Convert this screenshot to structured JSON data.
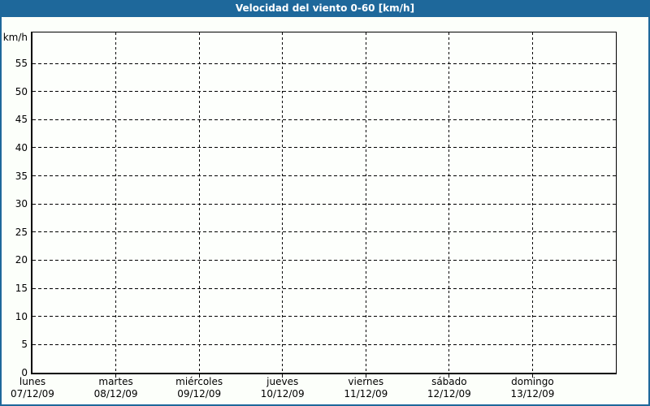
{
  "window": {
    "title": "Velocidad del viento 0-60 [km/h]"
  },
  "colors": {
    "titlebar_bg": "#1E689B",
    "titlebar_text": "#FFFFFF",
    "window_border": "#1E689B",
    "background": "#FCFFFA",
    "plot_background": "#FDFFFC",
    "grid_line": "#000000",
    "axis_line": "#000000",
    "tick_text": "#000000"
  },
  "chart_data": {
    "type": "line",
    "title": "Velocidad del viento 0-60 [km/h]",
    "ylabel": "km/h",
    "xlabel": "",
    "ylim": [
      0,
      60.5
    ],
    "yticks": [
      0,
      5,
      10,
      15,
      20,
      25,
      30,
      35,
      40,
      45,
      50,
      55
    ],
    "grid": "dashed",
    "legend": false,
    "categories": [
      {
        "day": "lunes",
        "date": "07/12/09"
      },
      {
        "day": "martes",
        "date": "08/12/09"
      },
      {
        "day": "miércoles",
        "date": "09/12/09"
      },
      {
        "day": "jueves",
        "date": "10/12/09"
      },
      {
        "day": "viernes",
        "date": "11/12/09"
      },
      {
        "day": "sábado",
        "date": "12/12/09"
      },
      {
        "day": "domingo",
        "date": "13/12/09"
      }
    ],
    "series": []
  }
}
